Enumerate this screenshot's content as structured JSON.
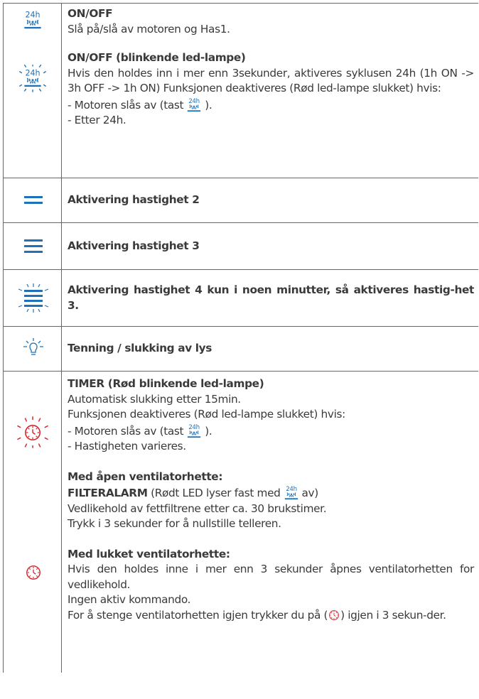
{
  "colors": {
    "blue": "#1f72b8",
    "red": "#d91f26",
    "border": "#666666",
    "text": "#3a3a3a"
  },
  "rows": {
    "onoff": {
      "icon": "24h-fan-icon",
      "title": "ON/OFF",
      "text": "Slå på/slå av motoren og Has1."
    },
    "onoff_blink": {
      "icon": "24h-fan-blinking-icon",
      "title": "ON/OFF (blinkende led-lampe)",
      "text": "Hvis den holdes inn i mer enn 3sekunder, aktiveres syklusen 24h (1h ON -> 3h OFF -> 1h ON) Funksjonen deaktiveres (Rød led-lampe slukket) hvis:",
      "item1_pre": "- Motoren slås av (tast",
      "item1_post": ").",
      "item2": "- Etter 24h."
    },
    "speed2": {
      "icon": "speed-2-icon",
      "title": "Aktivering hastighet 2"
    },
    "speed3": {
      "icon": "speed-3-icon",
      "title": "Aktivering hastighet 3"
    },
    "speed4": {
      "icon": "speed-4-blinking-icon",
      "title": "Aktivering hastighet 4 kun i noen minutter, så aktiveres hastig-het 3."
    },
    "light": {
      "icon": "light-bulb-icon",
      "title": "Tenning / slukking av lys"
    },
    "timer": {
      "icon": "timer-blinking-icon",
      "title": "TIMER (Rød blinkende led-lampe)",
      "line1": "Automatisk slukking etter 15min.",
      "line2": "Funksjonen deaktiveres (Rød led-lampe slukket) hvis:",
      "item1_pre": "- Motoren slås av (tast",
      "item1_post": ").",
      "item2": "- Hastigheten varieres."
    },
    "filter": {
      "icon": "timer-icon",
      "open_title": "Med åpen ventilatorhette:",
      "alarm_label": "FILTERALARM",
      "alarm_pre": "(Rødt LED lyser fast med",
      "alarm_post": "av)",
      "open_line2": "Vedlikehold av fettfiltrene etter ca. 30 brukstimer.",
      "open_line3": "Trykk i 3 sekunder for å nullstille telleren.",
      "closed_title": "Med lukket ventilatorhette:",
      "closed_line1": "Hvis den holdes inne i mer enn 3 sekunder åpnes ventilatorhetten for vedlikehold.",
      "closed_line2": "Ingen aktiv kommando.",
      "closed_line3_pre": "For å stenge ventilatorhetten igjen trykker du på (",
      "closed_line3_post": ") igjen i 3 sekun-der."
    }
  },
  "inline": {
    "fan_24h": "24h",
    "icon_label_24h": "24h"
  }
}
